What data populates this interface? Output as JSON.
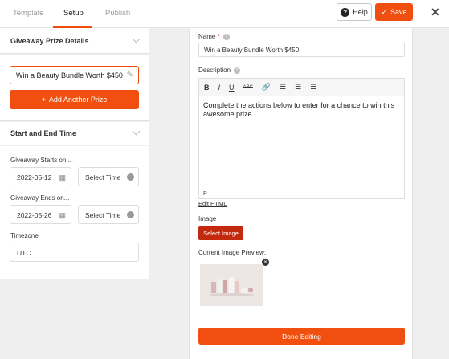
{
  "tabs": [
    {
      "label": "Template"
    },
    {
      "label": "Setup"
    },
    {
      "label": "Publish"
    }
  ],
  "header": {
    "help_label": "Help",
    "help_icon": "question-circle-icon",
    "save_label": "Save",
    "save_icon": "checkmark-icon",
    "close_icon": "close-icon"
  },
  "sidebar": {
    "prize_section_title": "Giveaway Prize Details",
    "prize_value": "Win a Beauty Bundle Worth $450",
    "add_prize_label": "Add Another Prize",
    "time_section_title": "Start and End Time",
    "starts_label": "Giveaway Starts on...",
    "start_date": "2022-05-12",
    "start_time_placeholder": "Select Time",
    "ends_label": "Giveaway Ends on...",
    "end_date": "2022-05-26",
    "end_time_placeholder": "Select Time",
    "timezone_label": "Timezone",
    "timezone_value": "UTC"
  },
  "editor": {
    "name_label": "Name",
    "name_required": "*",
    "name_value": "Win a Beauty Bundle Worth $450",
    "description_label": "Description",
    "toolbar": [
      "B",
      "I",
      "U",
      "ABC",
      "link",
      "align-left",
      "align-center",
      "align-right"
    ],
    "description_text": "Complete the actions below to enter for a chance to win this awesome prize.",
    "status_path": "P",
    "edit_html_label": "Edit HTML",
    "image_label": "Image",
    "select_image_label": "Select Image",
    "preview_label": "Current Image Preview:",
    "done_label": "Done Editing"
  },
  "colors": {
    "accent": "#f04f0f",
    "accent_dark": "#c3290c"
  }
}
